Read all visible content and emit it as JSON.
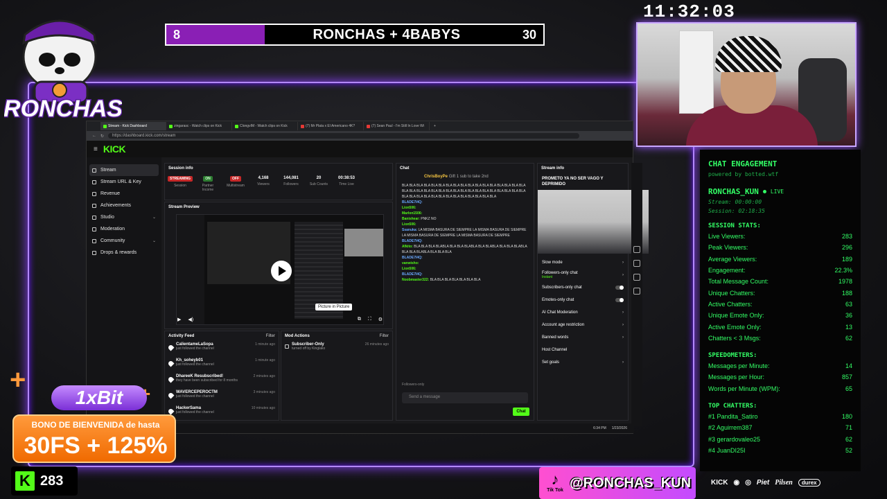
{
  "scoreboard": {
    "left_score": "8",
    "title": "RONCHAS + 4BABYS",
    "right_score": "30"
  },
  "clock": "11:32:03",
  "logo": {
    "text": "RONCHAS"
  },
  "browser": {
    "tabs": [
      {
        "label": "Stream - Kick Dashboard",
        "active": true
      },
      {
        "label": "zingarasc - Watch clips on Kick"
      },
      {
        "label": "ClongvIM - Watch clips on Kick"
      },
      {
        "label": "(7) Mr Plata x El Americano 4K?"
      },
      {
        "label": "(7) Sean Paul - I'm Still In Love Wi"
      }
    ],
    "url": "https://dashboard.kick.com/stream",
    "brand": "KICK",
    "sidebar": [
      {
        "label": "Stream",
        "active": true
      },
      {
        "label": "Stream URL & Key"
      },
      {
        "label": "Revenue"
      },
      {
        "label": "Achievements"
      },
      {
        "label": "Studio",
        "caret": "⌄"
      },
      {
        "label": "Moderation"
      },
      {
        "label": "Community",
        "caret": "⌄"
      },
      {
        "label": "Drops & rewards"
      }
    ],
    "session": {
      "title": "Session info",
      "stats": [
        {
          "value": "STREAMING",
          "label": "Session",
          "pill": "red"
        },
        {
          "value": "ON",
          "label": "Partner Income",
          "pill": "green"
        },
        {
          "value": "OFF",
          "label": "Multistream",
          "pill": "red"
        },
        {
          "value": "4,168",
          "label": "Viewers"
        },
        {
          "value": "144,081",
          "label": "Followers"
        },
        {
          "value": "20",
          "label": "Sub Counts"
        },
        {
          "value": "00:38:53",
          "label": "Time Live"
        }
      ]
    },
    "preview": {
      "title": "Stream Preview",
      "tooltip": "Picture in Picture"
    },
    "activity": {
      "title": "Activity Feed",
      "filter": "Filter",
      "items": [
        {
          "name": "CalientameLaSopa",
          "sub": "just followed the channel",
          "time": "1 minute ago"
        },
        {
          "name": "Kh_soheyb01",
          "sub": "just followed the channel",
          "time": "1 minute ago"
        },
        {
          "name": "DhareeK Resubscribed!",
          "sub": "they have been subscribed for 8 months",
          "time": "2 minutes ago"
        },
        {
          "name": "WAVERCEPEROCTM",
          "sub": "just followed the channel",
          "time": "3 minutes ago"
        },
        {
          "name": "HackerSama",
          "sub": "just followed the channel",
          "time": "10 minutes ago"
        }
      ]
    },
    "mod": {
      "title": "Mod Actions",
      "filter": "Filter",
      "item": {
        "name": "Subscriber-Only",
        "sub": "turned off by Kinglako",
        "time": "26 minutes ago"
      }
    },
    "chat": {
      "title": "Chat",
      "pinned_user": "ChrisBoyPe",
      "pinned_text": "Gift 1 sub to take 2nd",
      "lines": [
        {
          "user": "",
          "text": "BLA BLA BLA BLA BLA BLA BLA BLA BLA BLA BLA BLA BLA BLA BLA BLA BLA BLA BLA BLA BLA BLA BLA BLA BLA BLA BLA BLA BLA BLA BLA BLA BLA BLA BLA BLA BLA BLA BLA BLA BLA BLA BLA BLA BLA BLA BLA"
        },
        {
          "user": "BLADE7I4Q:",
          "text": ""
        },
        {
          "user": "Lion506:",
          "text": ""
        },
        {
          "user": "Marlon1506:",
          "text": ""
        },
        {
          "user": "Banishear:",
          "text": "PNKZ NO"
        },
        {
          "user": "Lion506:",
          "text": ""
        },
        {
          "user": "Ssanuka:",
          "text": "LA MISMA BASURA DE SIEMPRE LA MISMA BASURA DE SIEMPRE LA MISMA BASURA DE SIEMPRE LA MISMA BASURA DE SIEMPRE"
        },
        {
          "user": "BLADE7I4Q:",
          "text": ""
        },
        {
          "user": "Afkito:",
          "text": "BLA BLA BLA BLABLA BLA BLA BLABLA BLA BLABLA BLA BLA BLABLA BLA BLA BLABLA BLA BLA BLA"
        },
        {
          "user": "BLADE7I4Q:",
          "text": ""
        },
        {
          "user": "vanwisho:",
          "text": ""
        },
        {
          "user": "Lion506:",
          "text": ""
        },
        {
          "user": "BLADE7I4Q:",
          "text": ""
        },
        {
          "user": "Noobmaster322:",
          "text": "BLA BLA BLA BLA BLA BLA BLA"
        }
      ],
      "mode": "Followers-only",
      "placeholder": "Send a message",
      "send": "Chat"
    },
    "stream_info": {
      "title": "Stream info",
      "stream_title": "PROMETO YA NO SER VAGO Y DEPRIMIDO",
      "rows": [
        {
          "label": "Slow mode",
          "ctrl": "arrow"
        },
        {
          "label": "Followers-only chat",
          "sub": "Instant",
          "ctrl": "arrow"
        },
        {
          "label": "Subscribers-only chat",
          "ctrl": "toggle"
        },
        {
          "label": "Emotes-only chat",
          "ctrl": "toggle"
        },
        {
          "label": "AI Chat Moderation",
          "ctrl": "arrow"
        },
        {
          "label": "Account age restriction",
          "ctrl": "arrow"
        },
        {
          "label": "Banned words",
          "ctrl": "arrow"
        },
        {
          "label": "Host Channel",
          "ctrl": ""
        },
        {
          "label": "Set goals",
          "ctrl": "arrow"
        }
      ]
    },
    "taskbar": {
      "time": "6:34 PM",
      "date": "1/23/2026"
    }
  },
  "engagement": {
    "title": "CHAT ENGAGEMENT",
    "powered": "powered by botted.wtf",
    "user": "RONCHAS_KUN",
    "live": "LIVE",
    "stream_time": "Stream: 00:00:00",
    "session_time": "Session: 02:18:35",
    "sections": [
      {
        "title": "SESSION STATS:",
        "rows": [
          {
            "label": "Live Viewers:",
            "value": "283"
          },
          {
            "label": "Peak Viewers:",
            "value": "296"
          },
          {
            "label": "Average Viewers:",
            "value": "189"
          },
          {
            "label": "Engagement:",
            "value": "22.3%"
          },
          {
            "label": "Total Message Count:",
            "value": "1978"
          },
          {
            "label": "Unique Chatters:",
            "value": "188"
          },
          {
            "label": "Active Chatters:",
            "value": "63"
          },
          {
            "label": "Unique Emote Only:",
            "value": "36"
          },
          {
            "label": "Active Emote Only:",
            "value": "13"
          },
          {
            "label": "Chatters < 3 Msgs:",
            "value": "62"
          }
        ]
      },
      {
        "title": "SPEEDOMETERS:",
        "rows": [
          {
            "label": "Messages per Minute:",
            "value": "14"
          },
          {
            "label": "Messages per Hour:",
            "value": "857"
          },
          {
            "label": "Words per Minute (WPM):",
            "value": "65"
          }
        ]
      },
      {
        "title": "TOP CHATTERS:",
        "rows": [
          {
            "label": "#1 Pandita_Satiro",
            "value": "180"
          },
          {
            "label": "#2 Aguirrem387",
            "value": "71"
          },
          {
            "label": "#3 gerardovaleo25",
            "value": "62"
          },
          {
            "label": "#4 JuanDI25I",
            "value": "52"
          }
        ]
      }
    ]
  },
  "promo": {
    "brand": "1xBit",
    "line1": "BONO DE BIENVENIDA de hasta",
    "line2": "30FS + 125%"
  },
  "kick_viewers": {
    "icon": "K",
    "count": "283"
  },
  "tiktok": {
    "label": "Tik Tok",
    "handle": "@RONCHAS_KUN"
  },
  "sponsors": [
    "KICK",
    "Piet",
    "Pilsen",
    "durex"
  ],
  "colors": {
    "accent_purple": "#8a1fb5",
    "kick_green": "#53fc18",
    "terminal_green": "#33ff66"
  }
}
